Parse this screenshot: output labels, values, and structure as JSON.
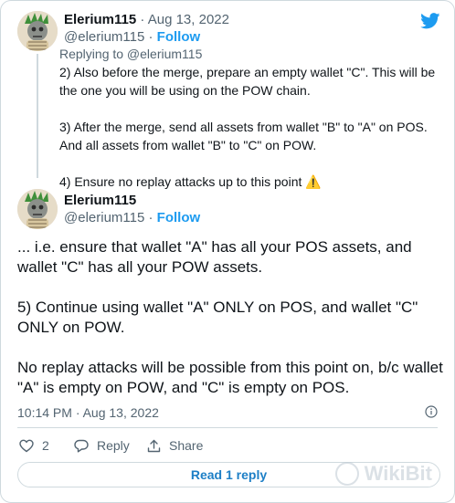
{
  "thread_tweet": {
    "author_name": "Elerium115",
    "date": "· Aug 13, 2022",
    "handle": "@elerium115 ·",
    "follow_label": "Follow",
    "replying_to": "Replying to @elerium115",
    "paragraphs": [
      "2) Also before the merge, prepare an empty wallet \"C\". This will be the one you will be using on the POW chain.",
      "3) After the merge, send all assets from wallet \"B\" to \"A\" on POS. And all assets from wallet \"B\" to \"C\" on POW.",
      "4) Ensure no replay attacks up to this point ⚠️"
    ]
  },
  "main_tweet": {
    "author_name": "Elerium115",
    "handle": "@elerium115 ·",
    "follow_label": "Follow",
    "paragraphs": [
      "... i.e. ensure that wallet \"A\" has all your POS assets, and wallet \"C\" has all your POW assets.",
      "5) Continue using wallet \"A\" ONLY on POS, and wallet \"C\" ONLY on POW.",
      "No replay attacks will be possible from this point on, b/c wallet \"A\" is empty on POW, and \"C\" is empty on POS."
    ],
    "timestamp": "10:14 PM · Aug 13, 2022"
  },
  "actions": {
    "like_count": "2",
    "reply_label": "Reply",
    "share_label": "Share"
  },
  "read_replies_label": "Read 1 reply",
  "watermark_text": "WikiBit",
  "colors": {
    "accent": "#1d9bf0",
    "link_button": "#1d7fc6",
    "muted": "#536471",
    "border": "#cfd9de"
  }
}
